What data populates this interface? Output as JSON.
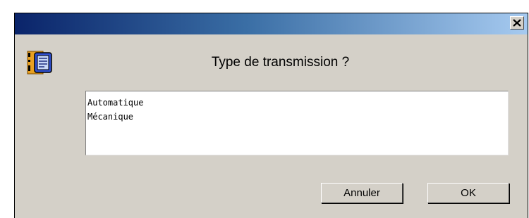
{
  "dialog": {
    "close_icon": "close-icon",
    "message_icon": "message-icon",
    "prompt": "Type de transmission ?"
  },
  "options": [
    {
      "label": "Automatique"
    },
    {
      "label": "Mécanique"
    }
  ],
  "buttons": {
    "cancel_label": "Annuler",
    "ok_label": "OK"
  },
  "colors": {
    "titlebar_start": "#0a246a",
    "titlebar_end": "#a6caf0",
    "dialog_background": "#d4d0c8",
    "list_background": "#ffffff"
  }
}
